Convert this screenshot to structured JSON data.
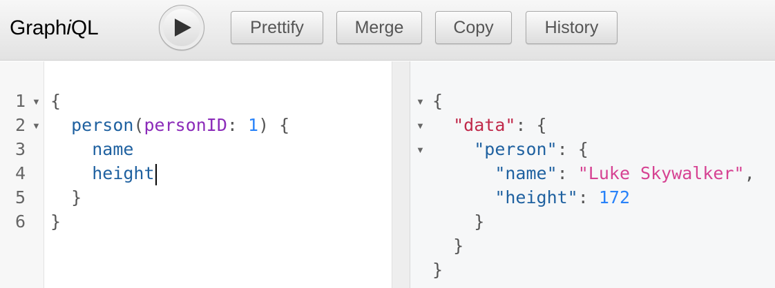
{
  "toolbar": {
    "logo_part1": "Graph",
    "logo_part2": "i",
    "logo_part3": "QL",
    "execute_icon": "play-icon",
    "buttons": {
      "prettify": "Prettify",
      "merge": "Merge",
      "copy": "Copy",
      "history": "History"
    }
  },
  "editor": {
    "line_numbers": [
      "1",
      "2",
      "3",
      "4",
      "5",
      "6"
    ],
    "l1_brace": "{",
    "l2_field": "person",
    "l2_open": "(",
    "l2_arg": "personID",
    "l2_colon": ": ",
    "l2_value": "1",
    "l2_close": ") {",
    "l3_field": "name",
    "l4_field": "height",
    "l5_brace": "}",
    "l6_brace": "}"
  },
  "result": {
    "open_brace": "{",
    "data_key": "\"data\"",
    "person_key": "\"person\"",
    "name_key": "\"name\"",
    "name_value": "\"Luke Skywalker\"",
    "height_key": "\"height\"",
    "height_value": "172",
    "colon": ": ",
    "open_obj": "{",
    "comma": ",",
    "close_brace": "}"
  },
  "colors": {
    "field": "#1f61a0",
    "argument": "#8b2bb9",
    "number": "#2882f9",
    "string": "#d64292",
    "data_key": "#c0294a"
  }
}
